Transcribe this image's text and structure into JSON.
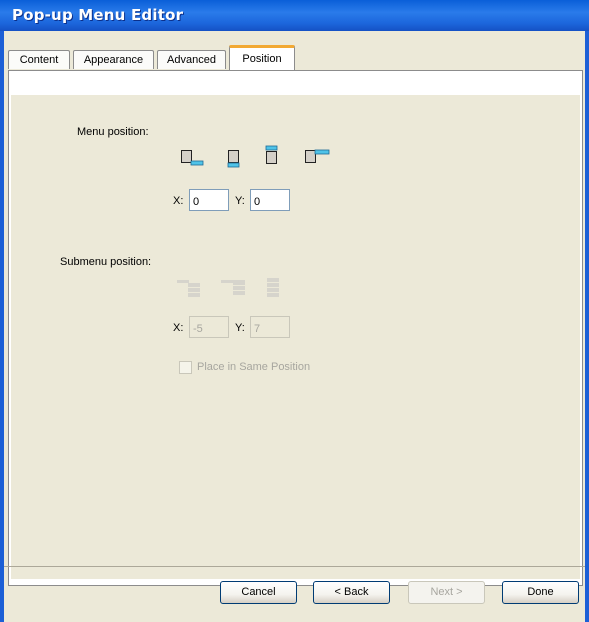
{
  "window": {
    "title": "Pop-up Menu Editor"
  },
  "tabs": [
    {
      "label": "Content"
    },
    {
      "label": "Appearance"
    },
    {
      "label": "Advanced"
    },
    {
      "label": "Position"
    }
  ],
  "active_tab": "Position",
  "menu_position": {
    "label": "Menu position:",
    "options": [
      "below-right-icon",
      "below-icon",
      "above-icon",
      "right-icon"
    ],
    "x_label": "X:",
    "x_value": "0",
    "y_label": "Y:",
    "y_value": "0"
  },
  "submenu_position": {
    "label": "Submenu position:",
    "options": [
      "submenu-top-right-icon",
      "submenu-right-icon",
      "submenu-below-icon"
    ],
    "x_label": "X:",
    "x_value": "-5",
    "y_label": "Y:",
    "y_value": "7",
    "checkbox_label": "Place in Same Position",
    "checkbox_checked": false,
    "disabled": true
  },
  "buttons": {
    "cancel": "Cancel",
    "back": "< Back",
    "next": "Next >",
    "done": "Done"
  },
  "colors": {
    "title_bar": "#1c66dc",
    "active_tab_accent": "#f2a933",
    "icon_highlight": "#4fc3e8",
    "dialog_bg": "#ece9d8"
  }
}
